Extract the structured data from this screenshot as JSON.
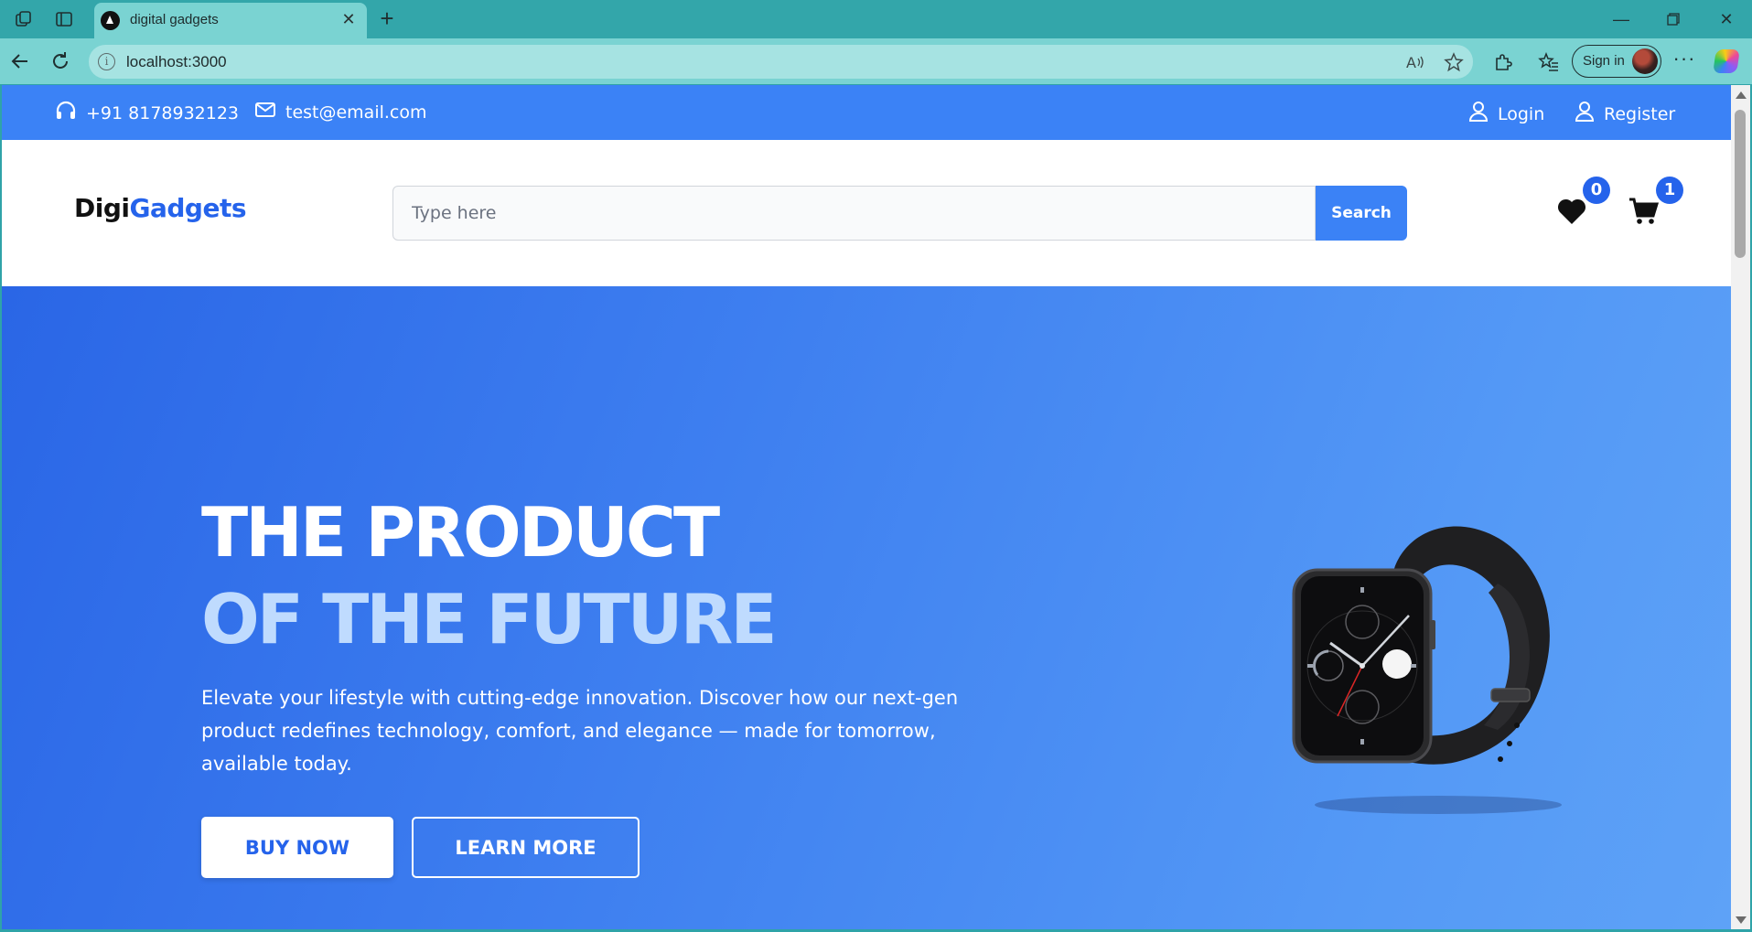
{
  "browser": {
    "tab_title": "digital gadgets",
    "url": "localhost:3000",
    "signin_label": "Sign in"
  },
  "topbar": {
    "phone": "+91 8178932123",
    "email": "test@email.com",
    "login_label": "Login",
    "register_label": "Register"
  },
  "header": {
    "logo_part1": "Digi",
    "logo_part2": "Gadgets",
    "search_placeholder": "Type here",
    "search_button": "Search",
    "wishlist_count": "0",
    "cart_count": "1"
  },
  "hero": {
    "title_line1": "THE PRODUCT",
    "title_line2": "OF THE FUTURE",
    "description": "Elevate your lifestyle with cutting-edge innovation. Discover how our next-gen product redefines technology, comfort, and elegance — made for tomorrow, available today.",
    "buy_label": "BUY NOW",
    "learn_label": "LEARN MORE"
  },
  "colors": {
    "brand": "#3b82f6",
    "brand_dark": "#2563eb",
    "title_accent": "#bfdbfe",
    "chrome": "#33a6aa"
  },
  "icons": [
    "workspaces-icon",
    "tab-actions-icon",
    "back-icon",
    "reload-icon",
    "read-aloud-icon",
    "favorite-icon",
    "extensions-icon",
    "favorites-icon",
    "more-icon",
    "copilot-icon",
    "headphones-icon",
    "mail-icon",
    "user-icon",
    "heart-icon",
    "cart-icon"
  ]
}
